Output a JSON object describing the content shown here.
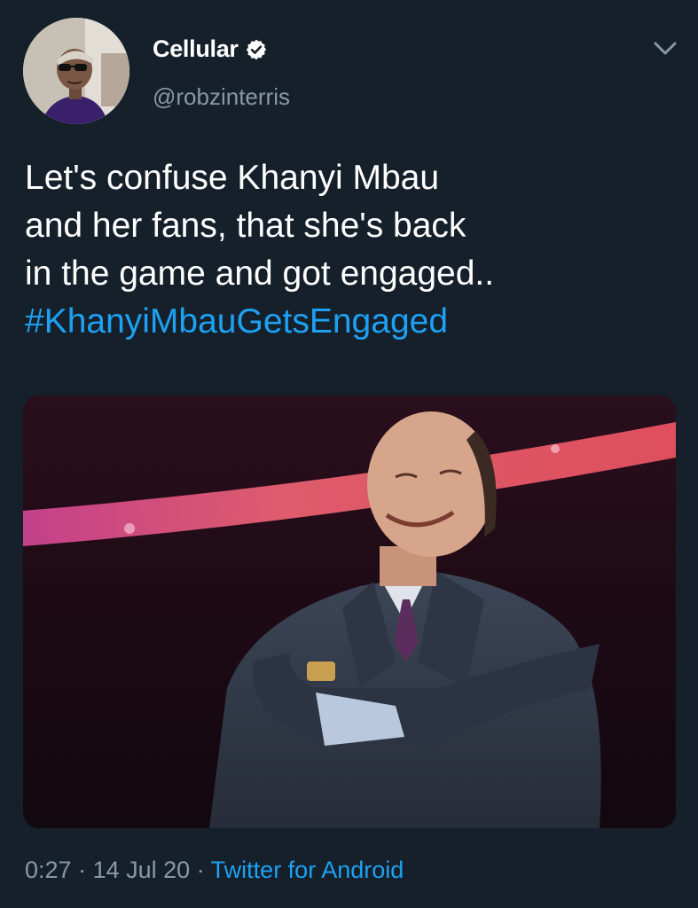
{
  "user": {
    "display_name": "Cellular",
    "handle": "@robzinterris",
    "verified": true
  },
  "tweet": {
    "lines": [
      "Let's confuse Khanyi Mbau",
      "and her fans, that she's back",
      "in the game and got engaged.."
    ],
    "hashtag": "#KhanyiMbauGetsEngaged"
  },
  "media": {
    "icon": "photo-man-in-suit-arms-crossed"
  },
  "meta": {
    "time": "0:27",
    "sep1": " · ",
    "date": "14 Jul 20",
    "sep2": " · ",
    "source": "Twitter for Android"
  },
  "colors": {
    "background": "#15202b",
    "accent": "#1da1f2",
    "secondary_text": "#8899a6"
  }
}
